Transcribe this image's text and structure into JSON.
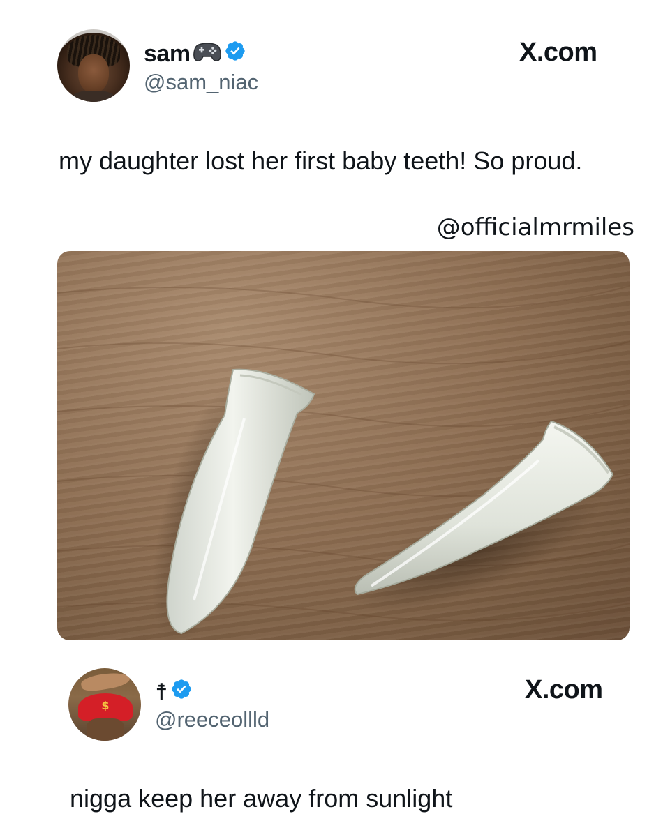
{
  "tweets": [
    {
      "display_name": "sam",
      "name_emoji": "controller-icon",
      "verified": true,
      "handle": "@sam_niac",
      "source_logo": "X.com",
      "text": "my daughter lost her first baby teeth! So proud.",
      "watermark": "@officialmrmiles",
      "photo": "two-white-fang-teeth-on-wooden-surface"
    },
    {
      "display_name": "☨",
      "verified": true,
      "handle": "@reeceollld",
      "source_logo": "X.com",
      "text": "nigga keep her away from sunlight"
    }
  ],
  "colors": {
    "text_primary": "#0f1419",
    "text_secondary": "#536471",
    "verified_blue": "#1d9bf0",
    "background": "#ffffff"
  }
}
